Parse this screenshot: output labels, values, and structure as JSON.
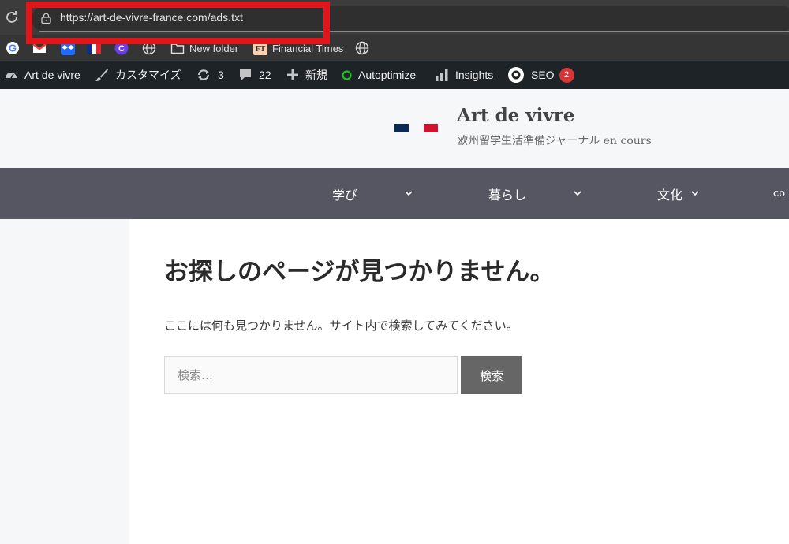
{
  "browser": {
    "url": "https://art-de-vivre-france.com/ads.txt",
    "bookmarks": [
      {
        "icon": "google-icon",
        "label": ""
      },
      {
        "icon": "gmail-icon",
        "label": ""
      },
      {
        "icon": "dropbox-icon",
        "label": ""
      },
      {
        "icon": "france-flag-icon",
        "label": ""
      },
      {
        "icon": "c-app-icon",
        "label": ""
      },
      {
        "icon": "globe-icon",
        "label": ""
      },
      {
        "icon": "folder-icon",
        "label": "New folder"
      },
      {
        "icon": "financial-times-icon",
        "label": "Financial Times"
      },
      {
        "icon": "globe-icon",
        "label": ""
      }
    ]
  },
  "adminbar": {
    "site_name": "Art de vivre",
    "customize": "カスタマイズ",
    "updates_count": "3",
    "comments_count": "22",
    "new_label": "新規",
    "autoptimize": "Autoptimize",
    "insights": "Insights",
    "seo": "SEO",
    "seo_badge": "2"
  },
  "header": {
    "site_title": "Art de vivre",
    "tagline": "欧州留学生活準備ジャーナル en cours"
  },
  "nav": {
    "items": [
      {
        "label": "学び"
      },
      {
        "label": "暮らし"
      },
      {
        "label": "文化"
      },
      {
        "label": "co"
      }
    ]
  },
  "content": {
    "title": "お探しのページが見つかりません。",
    "message": "ここには何も見つかりません。サイト内で検索してみてください。",
    "search_placeholder": "検索…",
    "search_button": "検索"
  },
  "colors": {
    "highlight_box": "#e0161b",
    "admin_bar": "#1d2327",
    "nav_bar": "#565663",
    "search_button": "#666666",
    "autoptimize_dot": "#20c020",
    "badge": "#d63638"
  }
}
